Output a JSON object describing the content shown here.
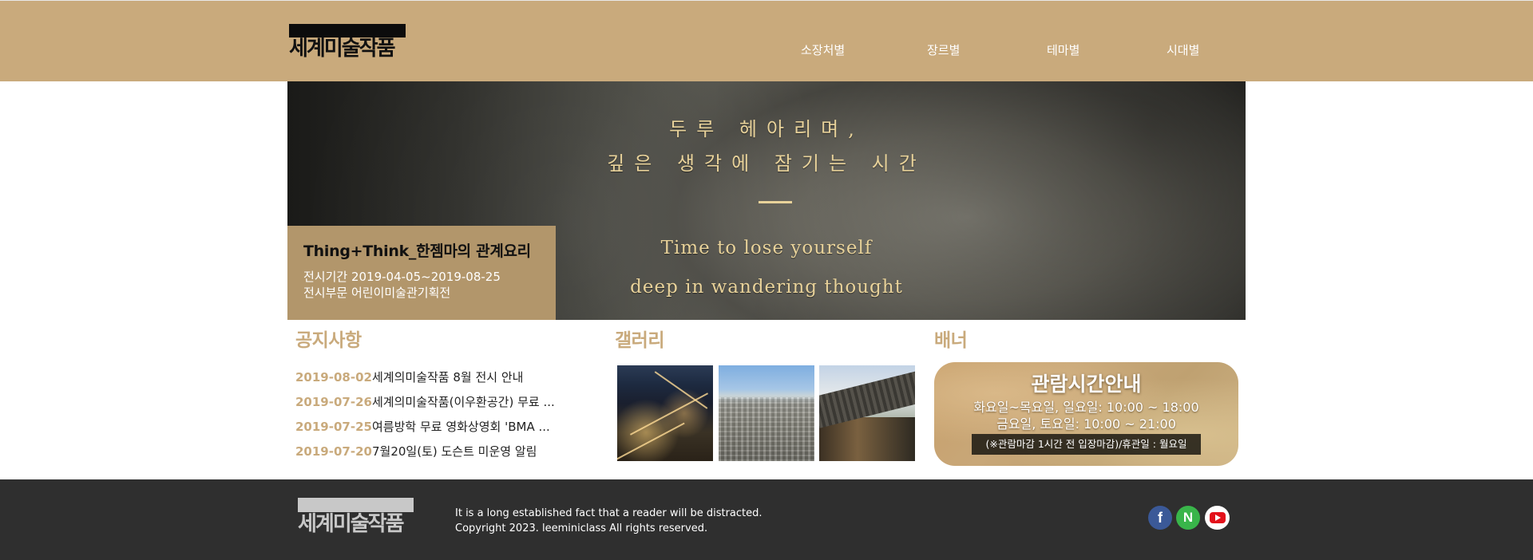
{
  "header": {
    "logo_text": "세계미술작품",
    "nav": [
      "소장처별",
      "장르별",
      "테마별",
      "시대별"
    ]
  },
  "hero": {
    "kor_line1": "두루 헤아리며,",
    "kor_line2": "깊은 생각에 잠기는 시간",
    "eng_line1": "Time to lose yourself",
    "eng_line2": "deep in wandering thought",
    "exhibit_title": "Thing+Think_한젬마의 관계요리",
    "period": "전시기간 2019-04-05~2019-08-25",
    "category": "전시부문 어린이미술관기획전"
  },
  "notice": {
    "title": "공지사항",
    "items": [
      {
        "date": "2019-08-02",
        "text": "세계의미술작품 8월 전시 안내"
      },
      {
        "date": "2019-07-26",
        "text": "세계의미술작품(이우환공간) 무료 ..."
      },
      {
        "date": "2019-07-25",
        "text": "여름방학 무료 영화상영회 'BMA ..."
      },
      {
        "date": "2019-07-20",
        "text": "7월20일(토) 도슨트 미운영 알림"
      }
    ]
  },
  "gallery": {
    "title": "갤러리"
  },
  "banner": {
    "title": "배너",
    "heading": "관람시간안내",
    "line1": "화요일~목요일, 일요일: 10:00 ~ 18:00",
    "line2": "금요일, 토요일: 10:00 ~ 21:00",
    "note": "(※관람마감 1시간 전 입장마감)/휴관일 : 월요일"
  },
  "footer": {
    "logo_text": "세계미술작품",
    "line1": "It is a long established fact that a reader will be distracted.",
    "line2": "Copyright 2023. leeminiclass All rights reserved.",
    "social": {
      "facebook": "f",
      "naver": "N",
      "youtube": "youtube-icon"
    }
  },
  "colors": {
    "accent": "#c9aa7c",
    "info_box": "#b2966b",
    "footer": "#2f2f2f"
  }
}
